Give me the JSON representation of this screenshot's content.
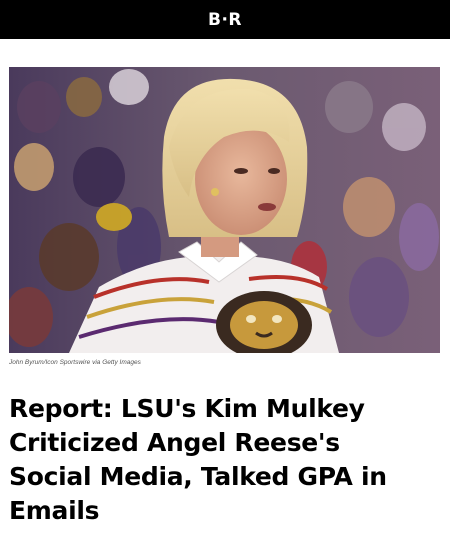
{
  "header": {
    "logo_text": "B·R",
    "background": "#000000"
  },
  "article": {
    "image": {
      "description_icon": "photo-image",
      "credit": "John Byrum/Icon Sportswire via Getty Images"
    },
    "headline": "Report: LSU's Kim Mulkey Criticized Angel Reese's Social Media, Talked GPA in Emails"
  }
}
